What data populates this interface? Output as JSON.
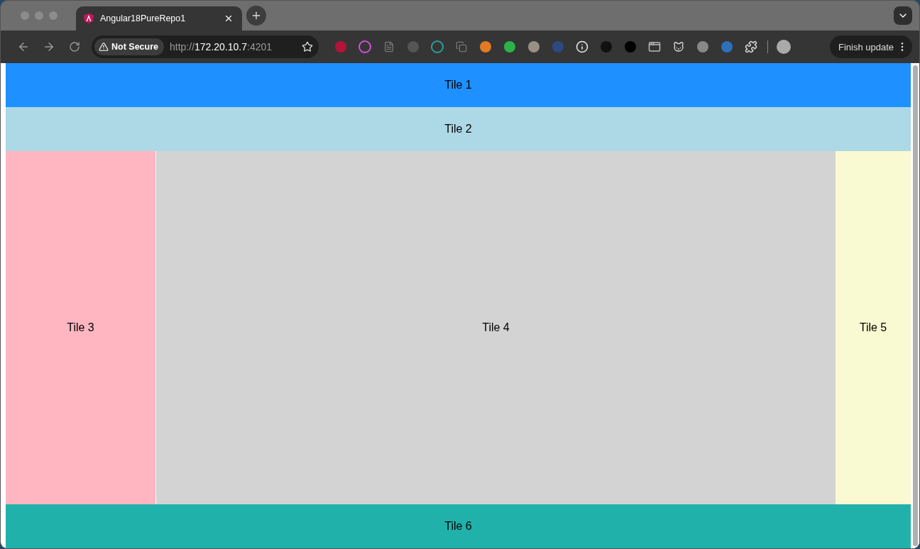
{
  "browser": {
    "tab": {
      "title": "Angular18PureRepo1",
      "selected": true
    },
    "security_chip": "Not Secure",
    "url": {
      "scheme": "http://",
      "host": "172.20.10.7",
      "port": ":4201"
    },
    "update_button": "Finish update"
  },
  "tiles": [
    {
      "label": "Tile 1",
      "kind": "header",
      "color": "#1e90ff"
    },
    {
      "label": "Tile 2",
      "kind": "header",
      "color": "#add8e6"
    },
    {
      "label": "Tile 3",
      "kind": "left",
      "color": "#ffb6c1"
    },
    {
      "label": "Tile 4",
      "kind": "main",
      "color": "#d3d3d3"
    },
    {
      "label": "Tile 5",
      "kind": "right",
      "color": "#fafad2"
    },
    {
      "label": "Tile 6",
      "kind": "footer",
      "color": "#20b2aa"
    }
  ]
}
